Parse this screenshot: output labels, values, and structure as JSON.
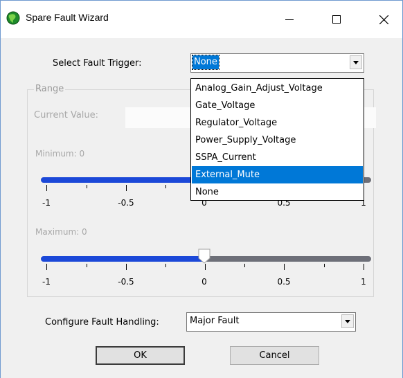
{
  "window": {
    "title": "Spare Fault Wizard"
  },
  "trigger": {
    "label": "Select Fault Trigger:",
    "value": "None",
    "options": [
      "Analog_Gain_Adjust_Voltage",
      "Gate_Voltage",
      "Regulator_Voltage",
      "Power_Supply_Voltage",
      "SSPA_Current",
      "External_Mute",
      "None"
    ],
    "highlighted": "External_Mute"
  },
  "range": {
    "legend": "Range",
    "current_value_label": "Current Value:",
    "minimum_label": "Minimum: 0",
    "maximum_label": "Maximum: 0",
    "tick_labels": [
      "-1",
      "-0.5",
      "0",
      "0.5",
      "1"
    ],
    "minimum_value": 0,
    "maximum_value": 0
  },
  "handling": {
    "label": "Configure Fault Handling:",
    "value": "Major Fault"
  },
  "buttons": {
    "ok": "OK",
    "cancel": "Cancel"
  },
  "colors": {
    "accent": "#0078d7",
    "track_active": "#1b48d8",
    "track_inactive": "#6d6f78"
  }
}
